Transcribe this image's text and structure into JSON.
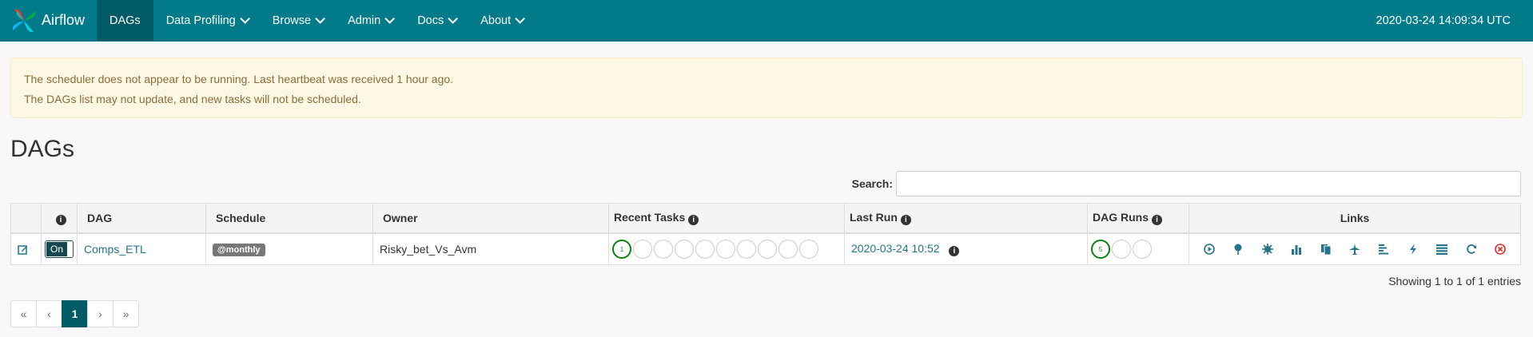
{
  "nav": {
    "brand": "Airflow",
    "items": [
      {
        "label": "DAGs",
        "dropdown": false,
        "active": true
      },
      {
        "label": "Data Profiling",
        "dropdown": true
      },
      {
        "label": "Browse",
        "dropdown": true
      },
      {
        "label": "Admin",
        "dropdown": true
      },
      {
        "label": "Docs",
        "dropdown": true
      },
      {
        "label": "About",
        "dropdown": true
      }
    ],
    "time": "2020-03-24 14:09:34 UTC"
  },
  "alert": {
    "line1": "The scheduler does not appear to be running. Last heartbeat was received 1 hour ago.",
    "line2": "The DAGs list may not update, and new tasks will not be scheduled."
  },
  "page": {
    "title": "DAGs"
  },
  "search": {
    "label": "Search:",
    "value": "",
    "placeholder": ""
  },
  "table": {
    "headers": {
      "dag": "DAG",
      "schedule": "Schedule",
      "owner": "Owner",
      "recent_tasks": "Recent Tasks",
      "last_run": "Last Run",
      "dag_runs": "DAG Runs",
      "links": "Links"
    },
    "rows": [
      {
        "toggle": "On",
        "dag": "Comps_ETL",
        "schedule": "@monthly",
        "owner": "Risky_bet_Vs_Avm",
        "recent_tasks_success": "1",
        "last_run": "2020-03-24 10:52",
        "dag_runs_success": "5"
      }
    ]
  },
  "footer": {
    "showing": "Showing 1 to 1 of 1 entries",
    "pager": {
      "first": "«",
      "prev": "‹",
      "current": "1",
      "next": "›",
      "last": "»"
    }
  },
  "colors": {
    "navbar": "#017b8a",
    "navbar_active": "#015b66",
    "link": "#22758b",
    "success": "#0a7f0a",
    "failed": "#d9302b"
  }
}
